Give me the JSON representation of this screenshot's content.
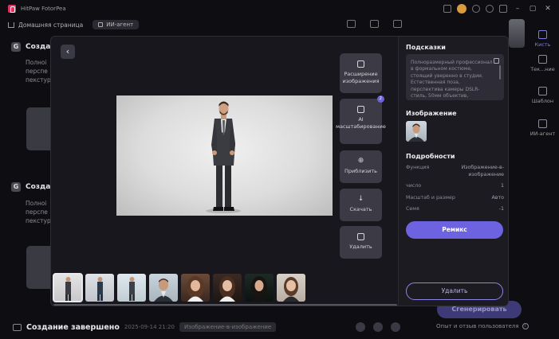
{
  "app": {
    "title": "HitPaw FotorPea"
  },
  "navbar": {
    "home_label": "Домашняя страница",
    "tab_label": "ИИ-агент"
  },
  "background": {
    "tasks": [
      {
        "title": "Создание",
        "lines": [
          "Полноі",
          "перспе",
          "пекстур"
        ]
      },
      {
        "title": "Создание",
        "lines": [
          "Полноі",
          "перспе",
          "пекстур"
        ]
      }
    ],
    "bottom": {
      "title": "Создание завершено",
      "date": "2025-09-14 21:20",
      "chip": "Изображение-в-изображение",
      "generate_label": "Сгенерировать",
      "feedback": "Опыт и отзыв пользователя"
    }
  },
  "right_sidebar": {
    "items": [
      "Кисть",
      "Тек...ние",
      "Шаблон",
      "ИИ-агент"
    ]
  },
  "modal": {
    "back_icon": "‹",
    "actions": [
      {
        "label": "Расширение изображения",
        "icon": "expand-icon"
      },
      {
        "label": "AI масштабирование",
        "icon": "upscale-icon",
        "badge": "2"
      },
      {
        "label": "Приблизить",
        "icon": "zoom-icon"
      },
      {
        "label": "Скачать",
        "icon": "download-icon"
      },
      {
        "label": "Удалить",
        "icon": "trash-icon"
      }
    ],
    "panel": {
      "hints_title": "Подсказки",
      "prompt": "Полноразмерный профессионал в формальном костюме, стоящий уверенно в студии. Естественная поза, перспектива камеры DSLR-стиль, 50мм объектив, реалистичное освещение с",
      "image_title": "Изображение",
      "details_title": "Подробности",
      "details": [
        {
          "key": "Функция",
          "value": "Изображение-в-изображение"
        },
        {
          "key": "число",
          "value": "1"
        },
        {
          "key": "Масштаб и размер",
          "value": "Авто"
        },
        {
          "key": "Семя",
          "value": "-1"
        }
      ],
      "remix_label": "Ремикс",
      "delete_label": "Удалить"
    }
  },
  "colors": {
    "accent": "#6d62e0",
    "panel_bg": "#1c1b22",
    "modal_bg": "#18171d"
  }
}
